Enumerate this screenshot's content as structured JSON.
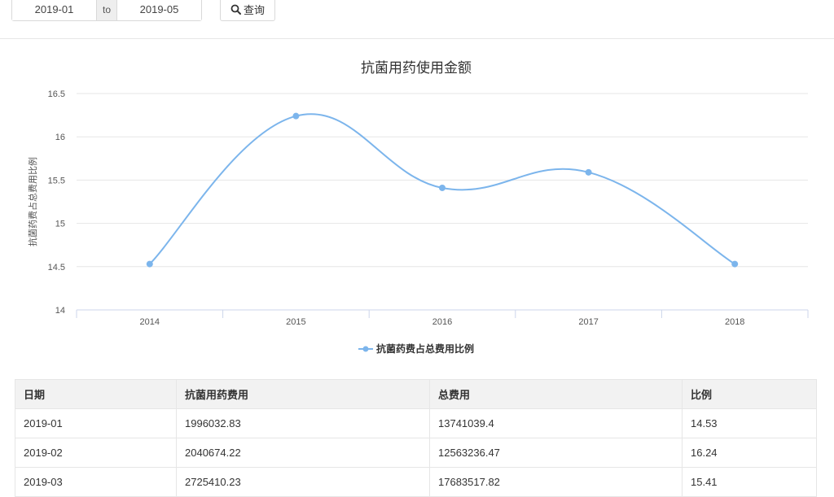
{
  "toolbar": {
    "start_value": "2019-01",
    "separator": "to",
    "end_value": "2019-05",
    "search_label": "查询"
  },
  "chart_data": {
    "type": "line",
    "title": "抗菌用药使用金额",
    "ylabel": "抗菌药费占总费用比例",
    "xlabel": "",
    "categories": [
      "2014",
      "2015",
      "2016",
      "2017",
      "2018"
    ],
    "series": [
      {
        "name": "抗菌药费占总费用比例",
        "values": [
          14.53,
          16.24,
          15.41,
          15.59,
          14.53
        ],
        "color": "#7cb5ec"
      }
    ],
    "ylim": [
      14,
      16.5
    ],
    "yticks": [
      "14",
      "14.5",
      "15",
      "15.5",
      "16",
      "16.5"
    ],
    "grid": true,
    "smooth": true,
    "legend_position": "bottom-center"
  },
  "table": {
    "headers": [
      "日期",
      "抗菌用药费用",
      "总费用",
      "比例"
    ],
    "rows": [
      [
        "2019-01",
        "1996032.83",
        "13741039.4",
        "14.53"
      ],
      [
        "2019-02",
        "2040674.22",
        "12563236.47",
        "16.24"
      ],
      [
        "2019-03",
        "2725410.23",
        "17683517.82",
        "15.41"
      ]
    ]
  }
}
